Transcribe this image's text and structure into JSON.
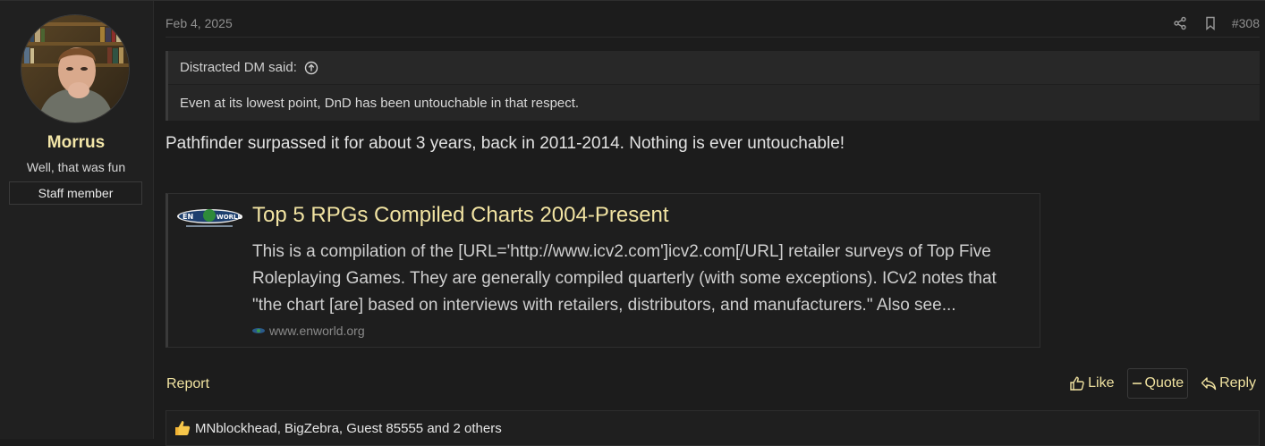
{
  "user": {
    "name": "Morrus",
    "title": "Well, that was fun",
    "badge": "Staff member"
  },
  "post": {
    "date": "Feb 4, 2025",
    "number": "#308",
    "message": "Pathfinder surpassed it for about 3 years, back in 2011-2014. Nothing is ever untouchable!"
  },
  "quote": {
    "author_line": "Distracted DM said:",
    "text": "Even at its lowest point, DnD has been untouchable in that respect."
  },
  "unfurl": {
    "title": "Top 5 RPGs Compiled Charts 2004-Present",
    "description": "This is a compilation of the [URL='http://www.icv2.com']icv2.com[/URL] retailer surveys of Top Five Roleplaying Games. They are generally compiled quarterly (with some exceptions). ICv2 notes that \"the chart [are] based on interviews with retailers, distributors, and manufacturers.\" Also see...",
    "source": "www.enworld.org",
    "logo_icon": "enworld-logo"
  },
  "actions": {
    "report": "Report",
    "like": "Like",
    "quote": "Quote",
    "reply": "Reply"
  },
  "reactions": {
    "text": "MNblockhead, BigZebra, Guest 85555 and 2 others"
  },
  "colors": {
    "accent": "#f0e2a0",
    "background": "#1c1c1c"
  }
}
